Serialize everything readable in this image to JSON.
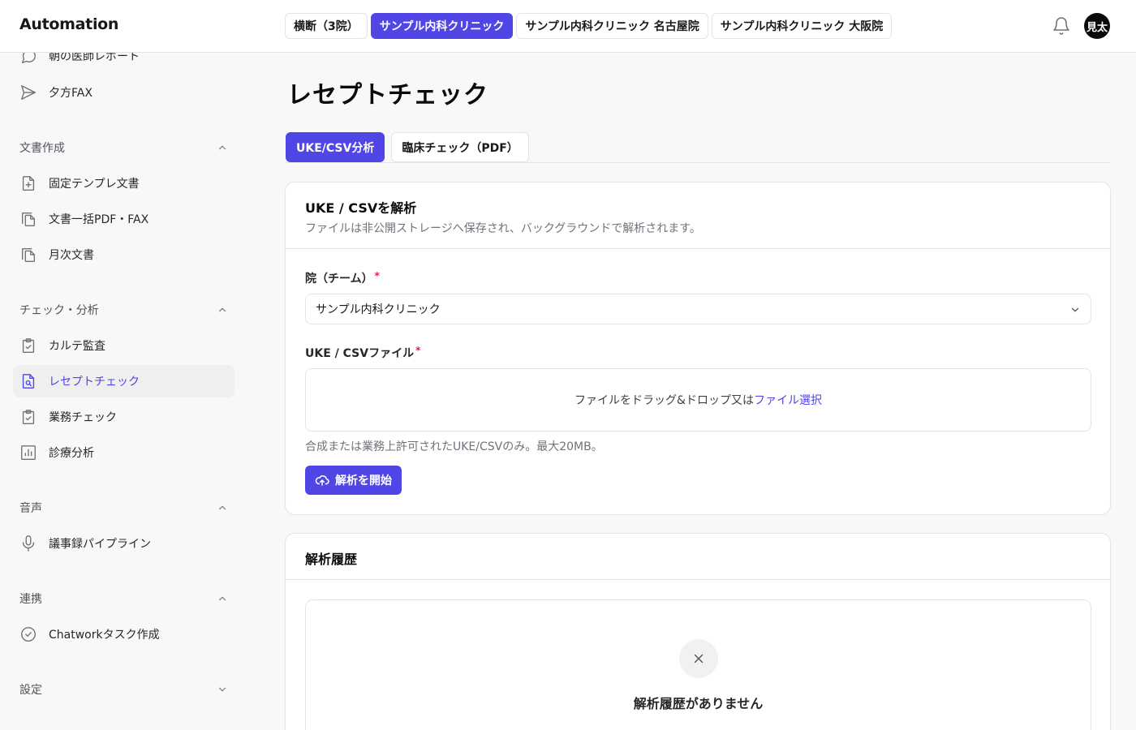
{
  "header": {
    "brand": "Automation",
    "clinic_tabs": [
      {
        "label": "横断（3院）",
        "active": false
      },
      {
        "label": "サンプル内科クリニック",
        "active": true
      },
      {
        "label": "サンプル内科クリニック 名古屋院",
        "active": false
      },
      {
        "label": "サンプル内科クリニック 大阪院",
        "active": false
      }
    ],
    "avatar_label": "見太"
  },
  "sidebar": {
    "items": [
      {
        "label": "朝の医師レポート",
        "icon": "chat-icon"
      },
      {
        "label": "夕方FAX",
        "icon": "send-icon"
      }
    ],
    "sections": [
      {
        "label": "文書作成",
        "expanded": true,
        "items": [
          {
            "label": "固定テンプレ文書",
            "icon": "file-plus-icon"
          },
          {
            "label": "文書一括PDF・FAX",
            "icon": "files-icon"
          },
          {
            "label": "月次文書",
            "icon": "files-icon"
          }
        ]
      },
      {
        "label": "チェック・分析",
        "expanded": true,
        "items": [
          {
            "label": "カルテ監査",
            "icon": "clipboard-check-icon"
          },
          {
            "label": "レセプトチェック",
            "icon": "file-search-icon",
            "active": true
          },
          {
            "label": "業務チェック",
            "icon": "clipboard-check-icon"
          },
          {
            "label": "診療分析",
            "icon": "chart-icon"
          }
        ]
      },
      {
        "label": "音声",
        "expanded": true,
        "items": [
          {
            "label": "議事録パイプライン",
            "icon": "mic-icon"
          }
        ]
      },
      {
        "label": "連携",
        "expanded": true,
        "items": [
          {
            "label": "Chatworkタスク作成",
            "icon": "check-circle-icon"
          }
        ]
      },
      {
        "label": "設定",
        "expanded": false,
        "items": []
      }
    ]
  },
  "main": {
    "title": "レセプトチェック",
    "tabs": [
      {
        "label": "UKE/CSV分析",
        "active": true
      },
      {
        "label": "臨床チェック（PDF）",
        "active": false
      }
    ],
    "upload_card": {
      "title": "UKE / CSVを解析",
      "description": "ファイルは非公開ストレージへ保存され、バックグラウンドで解析されます。",
      "team_label": "院（チーム）",
      "team_value": "サンプル内科クリニック",
      "file_label": "UKE / CSVファイル",
      "dropzone_text": "ファイルをドラッグ&ドロップ又は",
      "dropzone_link": "ファイル選択",
      "hint": "合成または業務上許可されたUKE/CSVのみ。最大20MB。",
      "start_button": "解析を開始",
      "required_mark": "*"
    },
    "history_card": {
      "title": "解析履歴",
      "empty_text": "解析履歴がありません"
    }
  },
  "colors": {
    "accent": "#4f46e5",
    "required": "#e11d48"
  }
}
